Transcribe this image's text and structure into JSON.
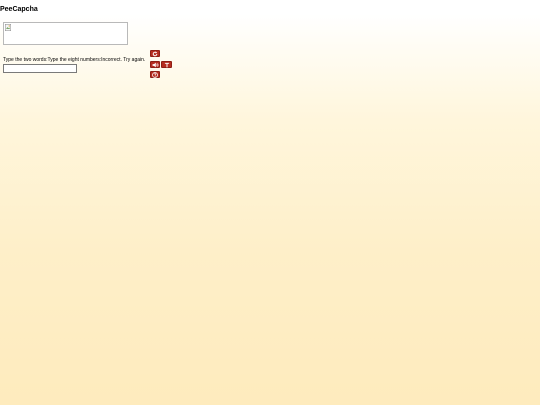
{
  "page": {
    "title": "PeeCapcha"
  },
  "captcha": {
    "instructions": "Type the two words:Type the eight numbers:Incorrect. Try again.",
    "response_value": "",
    "image_icon": "broken-image-icon"
  },
  "controls": {
    "reload_icon": "reload-icon",
    "audio_icon": "speaker-icon",
    "text_icon": "text-mode-icon",
    "help_icon": "help-icon",
    "button_color": "#b52d20"
  },
  "colors": {
    "background_top": "#ffffff",
    "background_bottom": "#feebbd"
  }
}
